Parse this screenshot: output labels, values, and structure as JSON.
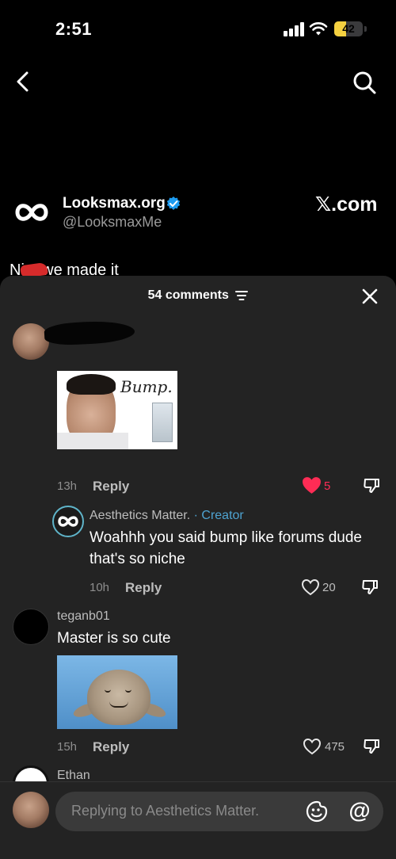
{
  "status": {
    "time": "2:51",
    "battery_level": "42",
    "battery_fraction": 0.42
  },
  "colors": {
    "accent_like": "#fe2c55",
    "creator": "#4ea3d1",
    "verified": "#1d9bf0",
    "battery": "#f5d140"
  },
  "nav": {
    "back_icon": "chevron-left-icon",
    "search_icon": "search-icon"
  },
  "post": {
    "account_name": "Looksmax.org",
    "handle": "@LooksmaxMe",
    "source": "𝕏.com",
    "caption": "Ni   a we made it"
  },
  "comments_sheet": {
    "count_label": "54 comments",
    "filter_icon": "filter-icon",
    "close_icon": "close-icon",
    "comments": [
      {
        "author": "",
        "image_text": "Bump.",
        "time": "13h",
        "reply_label": "Reply",
        "likes": "5",
        "liked": true
      },
      {
        "author": "Aesthetics Matter.",
        "author_tag": "· Creator",
        "text_line1": "Woahhh you said bump like forums dude",
        "text_line2": "that's so niche",
        "time": "10h",
        "reply_label": "Reply",
        "likes": "20",
        "liked": false
      },
      {
        "author": "teganb01",
        "text": "Master is so cute",
        "time": "15h",
        "reply_label": "Reply",
        "likes": "475",
        "liked": false
      },
      {
        "author": "Ethan"
      }
    ]
  },
  "composer": {
    "placeholder": "Replying to Aesthetics Matter.",
    "emoji_icon": "emoji-icon",
    "mention_label": "@"
  }
}
